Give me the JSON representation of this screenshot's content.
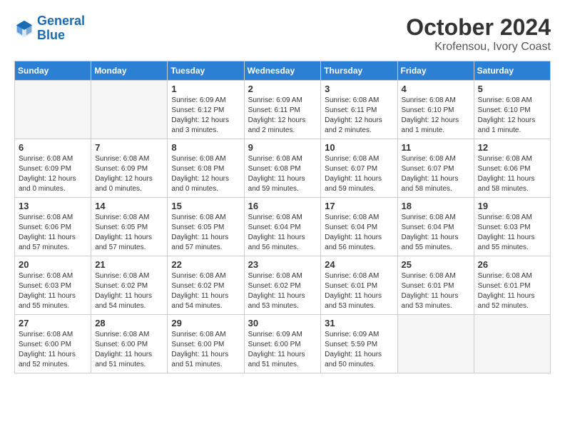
{
  "logo": {
    "line1": "General",
    "line2": "Blue"
  },
  "title": "October 2024",
  "subtitle": "Krofensou, Ivory Coast",
  "weekdays": [
    "Sunday",
    "Monday",
    "Tuesday",
    "Wednesday",
    "Thursday",
    "Friday",
    "Saturday"
  ],
  "weeks": [
    [
      {
        "day": "",
        "empty": true
      },
      {
        "day": "",
        "empty": true
      },
      {
        "day": "1",
        "info": "Sunrise: 6:09 AM\nSunset: 6:12 PM\nDaylight: 12 hours and 3 minutes."
      },
      {
        "day": "2",
        "info": "Sunrise: 6:09 AM\nSunset: 6:11 PM\nDaylight: 12 hours and 2 minutes."
      },
      {
        "day": "3",
        "info": "Sunrise: 6:08 AM\nSunset: 6:11 PM\nDaylight: 12 hours and 2 minutes."
      },
      {
        "day": "4",
        "info": "Sunrise: 6:08 AM\nSunset: 6:10 PM\nDaylight: 12 hours and 1 minute."
      },
      {
        "day": "5",
        "info": "Sunrise: 6:08 AM\nSunset: 6:10 PM\nDaylight: 12 hours and 1 minute."
      }
    ],
    [
      {
        "day": "6",
        "info": "Sunrise: 6:08 AM\nSunset: 6:09 PM\nDaylight: 12 hours and 0 minutes."
      },
      {
        "day": "7",
        "info": "Sunrise: 6:08 AM\nSunset: 6:09 PM\nDaylight: 12 hours and 0 minutes."
      },
      {
        "day": "8",
        "info": "Sunrise: 6:08 AM\nSunset: 6:08 PM\nDaylight: 12 hours and 0 minutes."
      },
      {
        "day": "9",
        "info": "Sunrise: 6:08 AM\nSunset: 6:08 PM\nDaylight: 11 hours and 59 minutes."
      },
      {
        "day": "10",
        "info": "Sunrise: 6:08 AM\nSunset: 6:07 PM\nDaylight: 11 hours and 59 minutes."
      },
      {
        "day": "11",
        "info": "Sunrise: 6:08 AM\nSunset: 6:07 PM\nDaylight: 11 hours and 58 minutes."
      },
      {
        "day": "12",
        "info": "Sunrise: 6:08 AM\nSunset: 6:06 PM\nDaylight: 11 hours and 58 minutes."
      }
    ],
    [
      {
        "day": "13",
        "info": "Sunrise: 6:08 AM\nSunset: 6:06 PM\nDaylight: 11 hours and 57 minutes."
      },
      {
        "day": "14",
        "info": "Sunrise: 6:08 AM\nSunset: 6:05 PM\nDaylight: 11 hours and 57 minutes."
      },
      {
        "day": "15",
        "info": "Sunrise: 6:08 AM\nSunset: 6:05 PM\nDaylight: 11 hours and 57 minutes."
      },
      {
        "day": "16",
        "info": "Sunrise: 6:08 AM\nSunset: 6:04 PM\nDaylight: 11 hours and 56 minutes."
      },
      {
        "day": "17",
        "info": "Sunrise: 6:08 AM\nSunset: 6:04 PM\nDaylight: 11 hours and 56 minutes."
      },
      {
        "day": "18",
        "info": "Sunrise: 6:08 AM\nSunset: 6:04 PM\nDaylight: 11 hours and 55 minutes."
      },
      {
        "day": "19",
        "info": "Sunrise: 6:08 AM\nSunset: 6:03 PM\nDaylight: 11 hours and 55 minutes."
      }
    ],
    [
      {
        "day": "20",
        "info": "Sunrise: 6:08 AM\nSunset: 6:03 PM\nDaylight: 11 hours and 55 minutes."
      },
      {
        "day": "21",
        "info": "Sunrise: 6:08 AM\nSunset: 6:02 PM\nDaylight: 11 hours and 54 minutes."
      },
      {
        "day": "22",
        "info": "Sunrise: 6:08 AM\nSunset: 6:02 PM\nDaylight: 11 hours and 54 minutes."
      },
      {
        "day": "23",
        "info": "Sunrise: 6:08 AM\nSunset: 6:02 PM\nDaylight: 11 hours and 53 minutes."
      },
      {
        "day": "24",
        "info": "Sunrise: 6:08 AM\nSunset: 6:01 PM\nDaylight: 11 hours and 53 minutes."
      },
      {
        "day": "25",
        "info": "Sunrise: 6:08 AM\nSunset: 6:01 PM\nDaylight: 11 hours and 53 minutes."
      },
      {
        "day": "26",
        "info": "Sunrise: 6:08 AM\nSunset: 6:01 PM\nDaylight: 11 hours and 52 minutes."
      }
    ],
    [
      {
        "day": "27",
        "info": "Sunrise: 6:08 AM\nSunset: 6:00 PM\nDaylight: 11 hours and 52 minutes."
      },
      {
        "day": "28",
        "info": "Sunrise: 6:08 AM\nSunset: 6:00 PM\nDaylight: 11 hours and 51 minutes."
      },
      {
        "day": "29",
        "info": "Sunrise: 6:08 AM\nSunset: 6:00 PM\nDaylight: 11 hours and 51 minutes."
      },
      {
        "day": "30",
        "info": "Sunrise: 6:09 AM\nSunset: 6:00 PM\nDaylight: 11 hours and 51 minutes."
      },
      {
        "day": "31",
        "info": "Sunrise: 6:09 AM\nSunset: 5:59 PM\nDaylight: 11 hours and 50 minutes."
      },
      {
        "day": "",
        "empty": true
      },
      {
        "day": "",
        "empty": true
      }
    ]
  ]
}
